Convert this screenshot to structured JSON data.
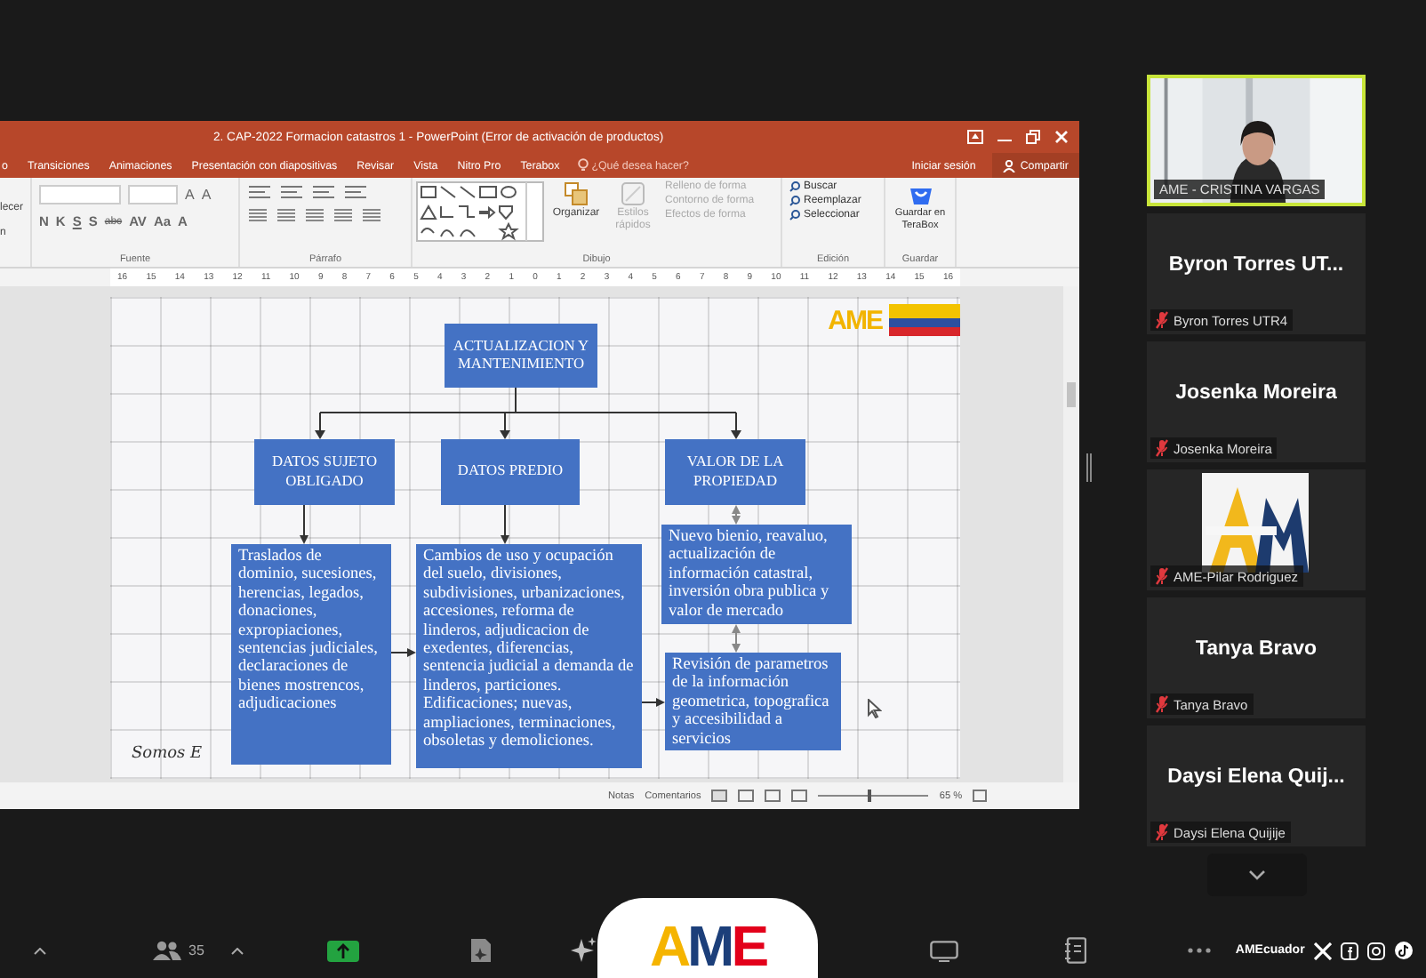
{
  "shared_window": {
    "title": "2. CAP-2022 Formacion catastros 1 - PowerPoint (Error de activación de productos)",
    "sign_in": "Iniciar sesión",
    "share": "Compartir",
    "tabs": [
      {
        "label": "o",
        "selected": false
      },
      {
        "label": "Transiciones",
        "selected": false
      },
      {
        "label": "Animaciones",
        "selected": false
      },
      {
        "label": "Presentación con diapositivas",
        "selected": false
      },
      {
        "label": "Revisar",
        "selected": false
      },
      {
        "label": "Vista",
        "selected": false
      },
      {
        "label": "Nitro Pro",
        "selected": false
      },
      {
        "label": "Terabox",
        "selected": false
      }
    ],
    "tell_me": {
      "placeholder": "¿Qué desea hacer?"
    },
    "ribbon": {
      "clipboard_fragments": [
        "lecer",
        "n"
      ],
      "font_buttons": [
        "N",
        "K",
        "S",
        "S",
        "abc",
        "AV",
        "Aa",
        "A"
      ],
      "size_buttons": [
        "A",
        "A"
      ],
      "drawing_commands": [
        "Organizar",
        "Estilos rápidos"
      ],
      "shape_format": [
        {
          "label": "Relleno de forma",
          "disabled": true
        },
        {
          "label": "Contorno de forma",
          "disabled": true
        },
        {
          "label": "Efectos de forma",
          "disabled": true
        }
      ],
      "editing": [
        "Buscar",
        "Reemplazar",
        "Seleccionar"
      ],
      "terabox": "Guardar en TeraBox",
      "groups": [
        "Fuente",
        "Párrafo",
        "Dibujo",
        "Edición",
        "Guardar"
      ]
    },
    "ruler": [
      "16",
      "15",
      "14",
      "13",
      "12",
      "11",
      "10",
      "9",
      "8",
      "7",
      "6",
      "5",
      "4",
      "3",
      "2",
      "1",
      "0",
      "1",
      "2",
      "3",
      "4",
      "5",
      "6",
      "7",
      "8",
      "9",
      "10",
      "11",
      "12",
      "13",
      "14",
      "15",
      "16"
    ],
    "slide": {
      "logo": "AME",
      "signature": "Somos E",
      "nodes": [
        {
          "text": "ACTUALIZACION Y MANTENIMIENTO"
        },
        {
          "text": "DATOS SUJETO OBLIGADO"
        },
        {
          "text": "DATOS PREDIO"
        },
        {
          "text": "VALOR DE LA PROPIEDAD"
        },
        {
          "text": "Traslados de dominio, sucesiones, herencias, legados, donaciones, expropiaciones, sentencias judiciales, declaraciones de bienes mostrencos, adjudicaciones"
        },
        {
          "text": "Cambios de uso y ocupación del suelo, divisiones, subdivisiones, urbanizaciones, accesiones, reforma de linderos, adjudicacion de exedentes, diferencias, sentencia judicial a demanda de linderos, particiones. Edificaciones; nuevas, ampliaciones, terminaciones, obsoletas y demoliciones."
        },
        {
          "text": "Nuevo bienio, reavaluo, actualización de información catastral, inversión obra publica y valor de mercado"
        },
        {
          "text": "Revisión de parametros de la información geometrica, topografica y accesibilidad a servicios"
        }
      ]
    },
    "status_bar": {
      "notes": "Notas",
      "comments": "Comentarios",
      "zoom": "65 %",
      "zoom_slider": {
        "level": 0.45
      }
    }
  },
  "participants": [
    {
      "kind": "video",
      "label": "AME - CRISTINA VARGAS",
      "speaking": true,
      "muted": false
    },
    {
      "kind": "name",
      "display_name": "Byron Torres UT...",
      "label": "Byron Torres UTR4",
      "speaking": false,
      "muted": true
    },
    {
      "kind": "name",
      "display_name": "Josenka Moreira",
      "label": "Josenka Moreira",
      "speaking": false,
      "muted": true
    },
    {
      "kind": "avatar",
      "label": "AME-Pilar Rodriguez",
      "speaking": false,
      "muted": true
    },
    {
      "kind": "name",
      "display_name": "Tanya Bravo",
      "label": "Tanya Bravo",
      "speaking": false,
      "muted": true
    },
    {
      "kind": "name",
      "display_name": "Daysi Elena Quij...",
      "label": "Daysi Elena Quijije",
      "speaking": false,
      "muted": true
    }
  ],
  "toolbar": {
    "participants_count": "35",
    "brand": "AME",
    "handle": "AMEcuador"
  }
}
